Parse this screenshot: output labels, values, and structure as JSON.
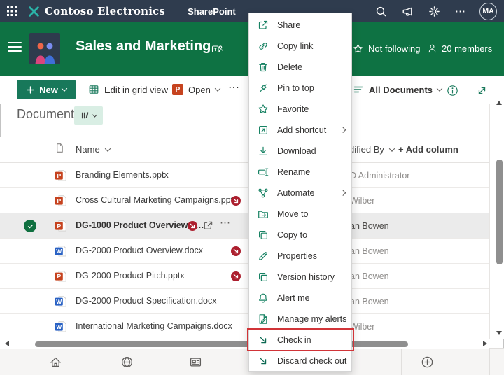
{
  "glyphs": {
    "ellipsis": "⋯",
    "plus": "+"
  },
  "colors": {
    "suite_bar_bg": "#2f3c4e",
    "site_header_green": "#0e7243",
    "new_button_green": "#18785a",
    "toolbar_icon_green": "#1b7a5d",
    "menu_icon_green": "#178263",
    "checkin_icon_teal": "#0c6952",
    "checked_out_red": "#ac1f2e",
    "annotation_red": "#d13438",
    "pill_mint": "#d9eee4",
    "selected_row_gray": "#ebebeb",
    "pptx_orange": "#c6431f",
    "docx_blue": "#2a62c4"
  },
  "suite_bar": {
    "brand": "Contoso Electronics",
    "product": "SharePoint",
    "avatar_initials": "MA"
  },
  "site_header": {
    "title": "Sales and Marketing",
    "follow_label": "Not following",
    "members_label": "20 members"
  },
  "toolbar": {
    "new_label": "New",
    "edit_grid_label": "Edit in grid view",
    "open_label": "Open",
    "view_selector_label": "All Documents"
  },
  "library": {
    "heading": "Documents",
    "columns": {
      "name_label": "Name",
      "modified_by_label": "Modified By",
      "add_column_label": "Add column"
    },
    "rows": [
      {
        "name": "Branding Elements.pptx",
        "type": "pptx",
        "checked_out": false,
        "selected": false,
        "modified_by_fragment": "D Administrator"
      },
      {
        "name": "Cross Cultural Marketing Campaigns.pptx",
        "type": "pptx",
        "checked_out": true,
        "selected": false,
        "modified_by_fragment": "Wilber"
      },
      {
        "name": "DG-1000 Product Overview.p…",
        "type": "pptx",
        "checked_out": true,
        "selected": true,
        "modified_by_fragment": "an Bowen"
      },
      {
        "name": "DG-2000 Product Overview.docx",
        "type": "docx",
        "checked_out": true,
        "selected": false,
        "modified_by_fragment": "an Bowen"
      },
      {
        "name": "DG-2000 Product Pitch.pptx",
        "type": "pptx",
        "checked_out": true,
        "selected": false,
        "modified_by_fragment": "an Bowen"
      },
      {
        "name": "DG-2000 Product Specification.docx",
        "type": "docx",
        "checked_out": false,
        "selected": false,
        "modified_by_fragment": "an Bowen"
      },
      {
        "name": "International Marketing Campaigns.docx",
        "type": "docx",
        "checked_out": false,
        "selected": false,
        "modified_by_fragment": "Wilber"
      }
    ],
    "file_type_letters": {
      "pptx": "P",
      "docx": "W"
    }
  },
  "context_menu": {
    "items": [
      {
        "id": "share",
        "label": "Share",
        "icon": "share"
      },
      {
        "id": "copy-link",
        "label": "Copy link",
        "icon": "link"
      },
      {
        "id": "delete",
        "label": "Delete",
        "icon": "trash"
      },
      {
        "id": "pin-to-top",
        "label": "Pin to top",
        "icon": "pin"
      },
      {
        "id": "favorite",
        "label": "Favorite",
        "icon": "star"
      },
      {
        "id": "add-shortcut",
        "label": "Add shortcut",
        "icon": "shortcut",
        "has_submenu": true
      },
      {
        "id": "download",
        "label": "Download",
        "icon": "download"
      },
      {
        "id": "rename",
        "label": "Rename",
        "icon": "rename"
      },
      {
        "id": "automate",
        "label": "Automate",
        "icon": "automate",
        "has_submenu": true
      },
      {
        "id": "move-to",
        "label": "Move to",
        "icon": "move"
      },
      {
        "id": "copy-to",
        "label": "Copy to",
        "icon": "copy"
      },
      {
        "id": "properties",
        "label": "Properties",
        "icon": "pencil"
      },
      {
        "id": "version-history",
        "label": "Version history",
        "icon": "history"
      },
      {
        "id": "alert-me",
        "label": "Alert me",
        "icon": "bell"
      },
      {
        "id": "manage-my-alerts",
        "label": "Manage my alerts",
        "icon": "manage"
      },
      {
        "id": "check-in",
        "label": "Check in",
        "icon": "checkin",
        "highlighted": true
      },
      {
        "id": "discard-check-out",
        "label": "Discard check out",
        "icon": "checkin"
      }
    ]
  }
}
